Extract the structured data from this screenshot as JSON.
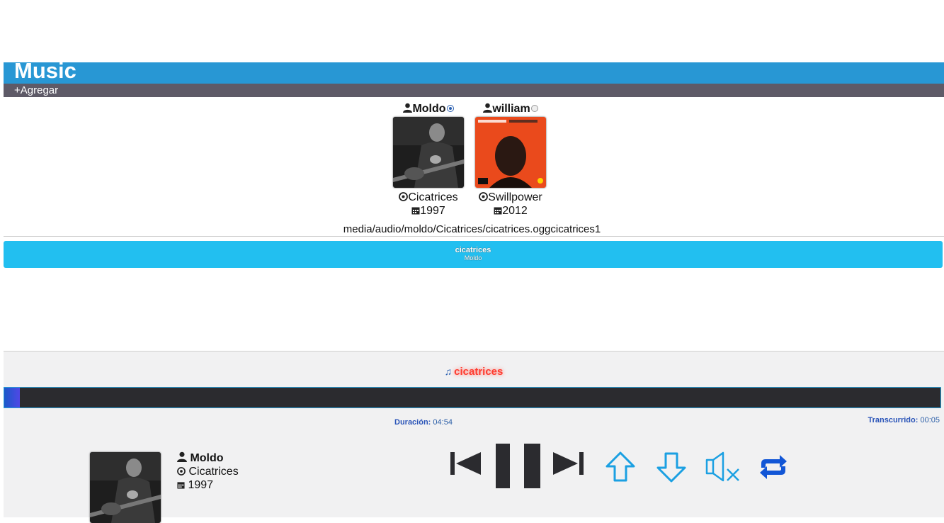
{
  "header": {
    "title": "Music",
    "add_label": "+Agregar"
  },
  "albums": [
    {
      "artist": "Moldo",
      "selected": true,
      "album": "Cicatrices",
      "year": "1997",
      "cover": "dark-guitarist-photo"
    },
    {
      "artist": "william",
      "selected": false,
      "album": "Swillpower",
      "year": "2012",
      "cover": "orange-portrait"
    }
  ],
  "path_text": "media/audio/moldo/Cicatrices/cicatrices.oggcicatrices1",
  "playlist": [
    {
      "title": "cicatrices",
      "artist": "Moldo"
    }
  ],
  "player": {
    "now_playing": "cicatrices",
    "duration_label": "Duración:",
    "duration_value": "04:54",
    "elapsed_label": "Transcurrido:",
    "elapsed_value": "00:05",
    "progress_fraction": 0.017,
    "current": {
      "artist": "Moldo",
      "album": "Cicatrices",
      "year": "1997"
    }
  },
  "colors": {
    "header": "#2897d4",
    "subbar": "#5e5a67",
    "track_bar": "#22bff0",
    "accent_red": "#ff3b2f",
    "control_blue": "#1ba0e2",
    "control_dark": "#2b2b2f"
  },
  "icons": [
    "user-icon",
    "disc-icon",
    "calendar-icon",
    "music-note-icon",
    "previous-icon",
    "pause-icon",
    "next-icon",
    "arrow-up-icon",
    "arrow-down-icon",
    "mute-icon",
    "repeat-icon"
  ]
}
